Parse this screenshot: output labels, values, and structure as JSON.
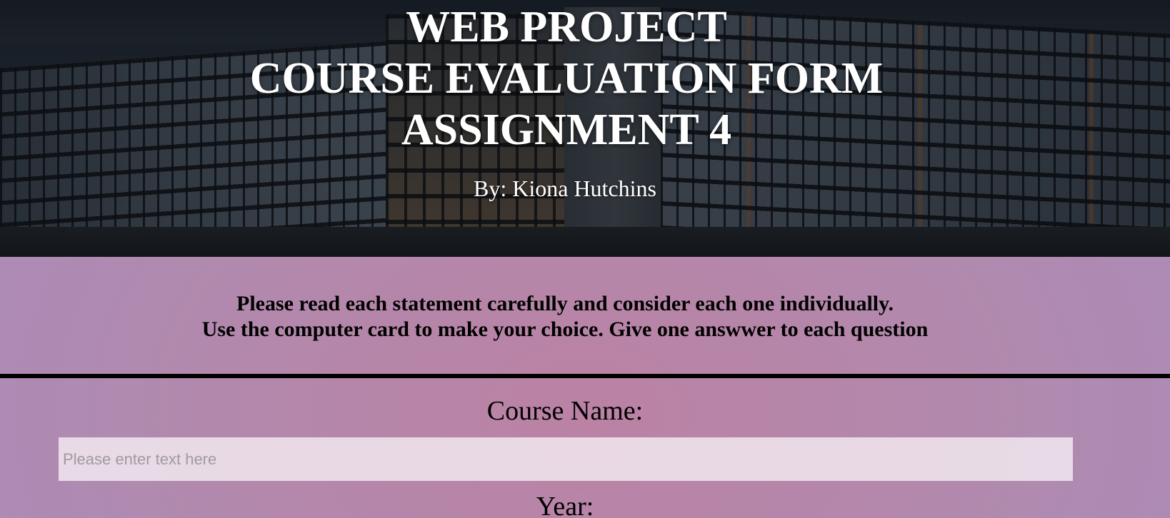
{
  "header": {
    "title_lines": [
      "WEB PROJECT",
      "COURSE EVALUATION FORM",
      "ASSIGNMENT 4"
    ],
    "byline": "By: Kiona Hutchins"
  },
  "instructions": {
    "lines": [
      "Please read each statement carefully and consider each one individually.",
      "Use the computer card to make your choice. Give one answwer to each question"
    ]
  },
  "form": {
    "course_name": {
      "label": "Course Name:",
      "value": "",
      "placeholder": "Please enter text here"
    },
    "year": {
      "label": "Year:"
    }
  },
  "colors": {
    "background": "#b088b0",
    "divider": "#000000",
    "title_text": "#ffffff",
    "input_background": "#ede3ec"
  }
}
